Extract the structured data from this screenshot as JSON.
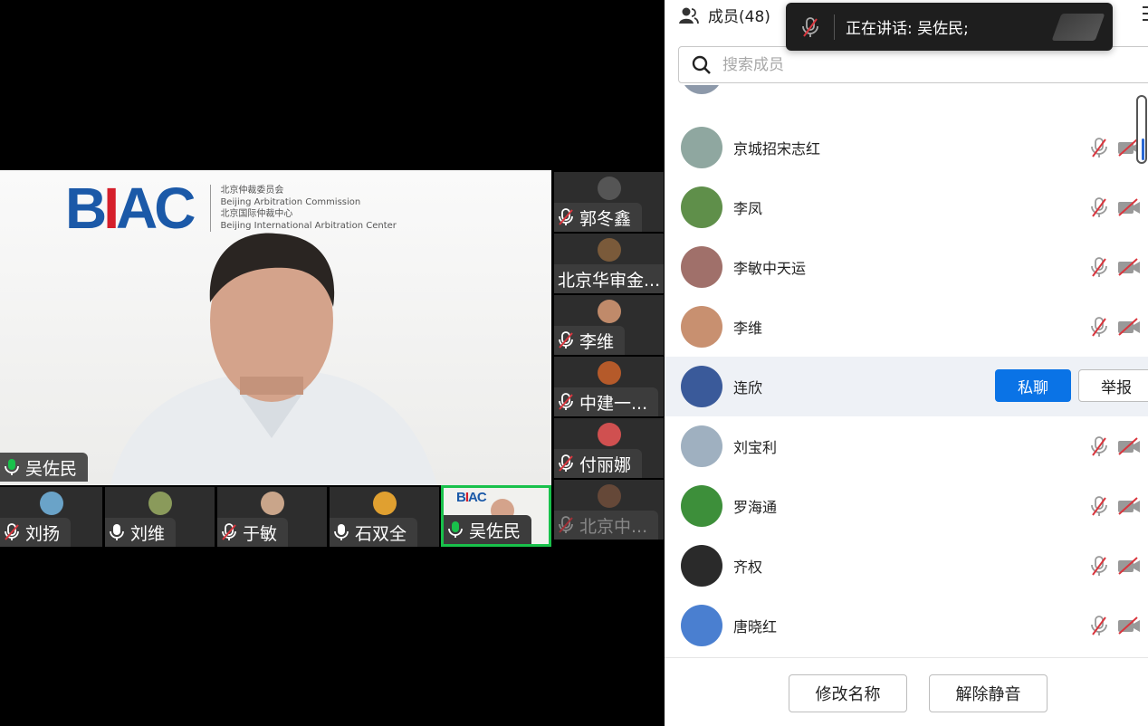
{
  "main_video": {
    "speaker_name": "吴佐民",
    "logo": {
      "mark_b": "B",
      "mark_i": "I",
      "mark_ac": "AC",
      "lines": [
        "北京仲裁委员会",
        "Beijing Arbitration Commission",
        "北京国际仲裁中心",
        "Beijing International Arbitration Center"
      ]
    }
  },
  "bottom_thumbs": [
    {
      "name": "刘扬",
      "mic": "muted",
      "avatar_color": "#6aa3c8"
    },
    {
      "name": "刘维",
      "mic": "on",
      "avatar_color": "#8a9a5b"
    },
    {
      "name": "于敏",
      "mic": "muted",
      "avatar_color": "#c9a58a"
    },
    {
      "name": "石双全",
      "mic": "on",
      "avatar_color": "#e0a030"
    },
    {
      "name": "吴佐民",
      "mic": "speaking",
      "avatar_color": "#f1f1ee"
    }
  ],
  "side_thumbs": [
    {
      "name": "郭冬鑫",
      "mic": "muted",
      "avatar_color": "#555555"
    },
    {
      "name": "北京华审金...",
      "mic": "none",
      "avatar_color": "#7a5a3a"
    },
    {
      "name": "李维",
      "mic": "muted",
      "avatar_color": "#c08a6a"
    },
    {
      "name": "中建一...",
      "mic": "muted",
      "avatar_color": "#b55a2a"
    },
    {
      "name": "付丽娜",
      "mic": "muted",
      "avatar_color": "#d05050"
    },
    {
      "name": "北京中...",
      "mic": "muted",
      "avatar_color": "#8a5a40"
    }
  ],
  "panel": {
    "title": "成员(48)",
    "toast": {
      "text": "正在讲话:  吴佐民;"
    },
    "search_placeholder": "搜索成员",
    "members": [
      {
        "name": "京城招宋志红",
        "avatar_color": "#8fa7a0"
      },
      {
        "name": "李凤",
        "avatar_color": "#5f8f4a"
      },
      {
        "name": "李敏中天运",
        "avatar_color": "#a0706a"
      },
      {
        "name": "李维",
        "avatar_color": "#c89070"
      },
      {
        "name": "连欣",
        "avatar_color": "#3a5a9a"
      },
      {
        "name": "刘宝利",
        "avatar_color": "#9fb0c0"
      },
      {
        "name": "罗海通",
        "avatar_color": "#3d8f3a"
      },
      {
        "name": "齐权",
        "avatar_color": "#2a2a2a"
      },
      {
        "name": "唐晓红",
        "avatar_color": "#4a7fd0"
      }
    ],
    "private_chat_label": "私聊",
    "report_label": "举报",
    "rename_label": "修改名称",
    "unmute_label": "解除静音"
  },
  "colors": {
    "accent": "#0a73e6",
    "speaking_green": "#19c14b",
    "muted_red": "#d9363e"
  }
}
